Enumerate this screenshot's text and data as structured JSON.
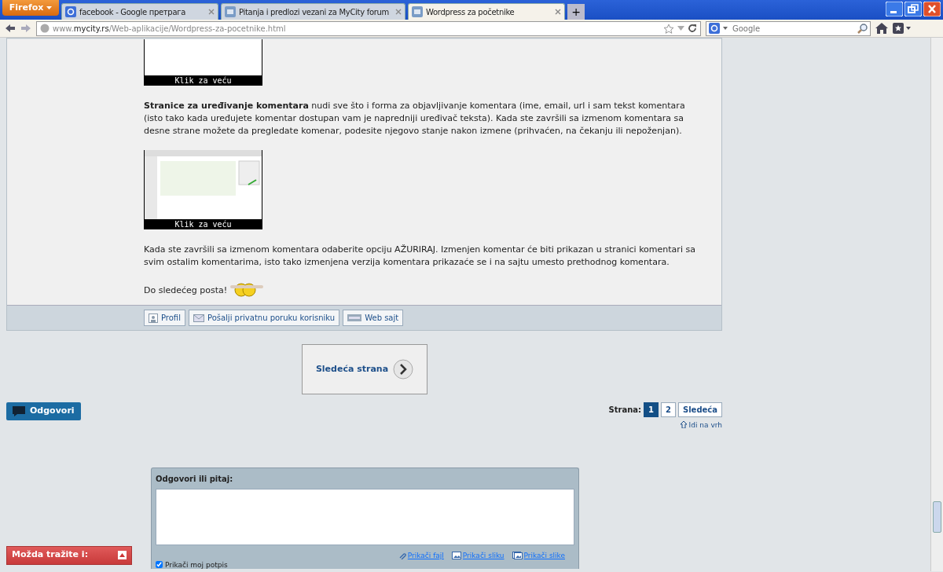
{
  "browser": {
    "menu_button": "Firefox",
    "tabs": [
      {
        "title": "facebook - Google претрага",
        "selected": false,
        "kind": "google"
      },
      {
        "title": "Pitanja i predlozi vezani za MyCity forum",
        "selected": false,
        "kind": "site"
      },
      {
        "title": "Wordpress za početnike",
        "selected": true,
        "kind": "site"
      }
    ],
    "new_tab": "+",
    "address": {
      "domain_prefix": "www.",
      "domain": "mycity.rs",
      "path": "/Web-aplikacije/Wordpress-za-pocetnike.html"
    },
    "search": {
      "placeholder": "Google"
    }
  },
  "post": {
    "blocks": [
      {
        "kind": "image",
        "caption": "Klik za veću",
        "cut": true
      },
      {
        "kind": "text",
        "text": "**Stranice za uređivanje komentara** nudi sve što i forma za objavljivanje komentara (ime, email, url i sam tekst komentara (isto tako kada uređujete komentar dostupan vam je napredniji uređivač teksta). Kada ste završili sa izmenom komentara sa desne strane možete da pregledate komenar, podesite njegovo stanje nakon izmene (prihvaćen, na čekanju ili nepoženjan)."
      },
      {
        "kind": "image",
        "caption": "Klik za veću",
        "cut": false
      },
      {
        "kind": "text",
        "text": "Kada ste završili sa izmenom komentara odaberite opciju AŽURIRAJ. Izmenjen komentar će biti prikazan u stranici komentari sa svim ostalim komentarima, isto tako izmenjena verzija komentara prikazaće se i na sajtu umesto prethodnog komentara."
      },
      {
        "kind": "signoff",
        "text": "Do sledećeg posta!"
      }
    ],
    "actions": [
      {
        "label": "Profil",
        "kind": "profile"
      },
      {
        "label": "Pošalji privatnu poruku korisniku",
        "kind": "message"
      },
      {
        "label": "Web sajt",
        "kind": "www"
      }
    ]
  },
  "next_page": "Sledeća strana",
  "reply_button": "Odgovori",
  "pagination": {
    "label": "Strana:",
    "pages": [
      {
        "label": "1",
        "selected": true
      },
      {
        "label": "2",
        "selected": false
      }
    ],
    "next": "Sledeća",
    "to_top": "Idi na vrh"
  },
  "reply_form": {
    "title": "Odgovori ili pitaj:",
    "attachments": [
      {
        "label": "Prikači fajl",
        "kind": "clip"
      },
      {
        "label": "Prikači sliku",
        "kind": "image"
      },
      {
        "label": "Prikači slike",
        "kind": "images"
      }
    ],
    "signature": {
      "label": "Prikači moj potpis",
      "checked": true
    }
  },
  "suggest_panel": {
    "title": "Možda tražite i:",
    "collapsed": false
  }
}
